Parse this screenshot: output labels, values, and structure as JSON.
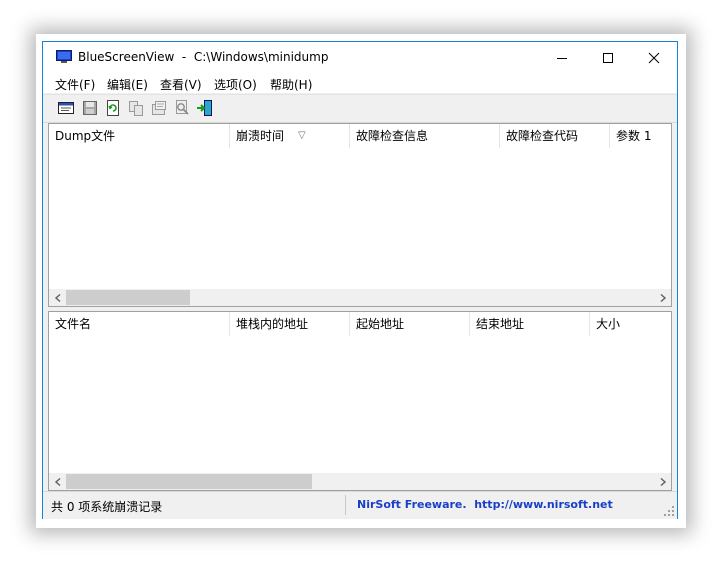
{
  "window": {
    "app_name": "BlueScreenView",
    "title": "BlueScreenView  -  C:\\Windows\\minidump"
  },
  "menu": [
    {
      "label": "文件(F)"
    },
    {
      "label": "编辑(E)"
    },
    {
      "label": "查看(V)"
    },
    {
      "label": "选项(O)"
    },
    {
      "label": "帮助(H)"
    }
  ],
  "toolbar": {
    "icons": [
      "html-report-icon",
      "save-icon",
      "refresh-icon",
      "copy-icon",
      "properties-icon",
      "search-icon",
      "exit-icon"
    ]
  },
  "crash_list": {
    "columns": [
      "Dump文件",
      "崩溃时间",
      "故障检查信息",
      "故障检查代码",
      "参数 1"
    ],
    "sort_indicator": "▽",
    "rows": []
  },
  "driver_list": {
    "columns": [
      "文件名",
      "堆栈内的地址",
      "起始地址",
      "结束地址",
      "大小"
    ],
    "rows": []
  },
  "status": {
    "left": "共 0 项系统崩溃记录",
    "right": "NirSoft Freeware.  http://www.nirsoft.net"
  },
  "colors": {
    "accent_border": "#1c7fd1",
    "link_blue": "#1a3fc7"
  }
}
